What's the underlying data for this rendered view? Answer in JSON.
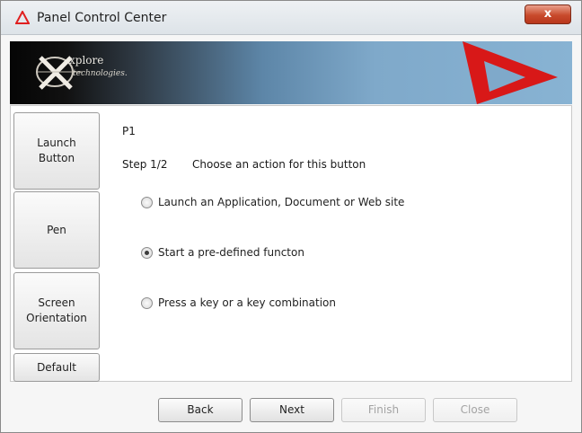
{
  "window": {
    "title": "Panel Control Center",
    "close_label": "x"
  },
  "banner": {
    "logo_line1": "xplore",
    "logo_line2": "technologies."
  },
  "sidebar": {
    "items": [
      {
        "lines": [
          "Launch",
          "Button"
        ]
      },
      {
        "lines": [
          "Pen"
        ]
      },
      {
        "lines": [
          "Screen",
          "Orientation"
        ]
      },
      {
        "lines": [
          "Default"
        ]
      }
    ]
  },
  "main": {
    "panel_label": "P1",
    "step": "Step 1/2",
    "step_description": "Choose an action for this button",
    "options": [
      {
        "label": "Launch an Application, Document or Web site",
        "selected": false
      },
      {
        "label": "Start a pre-defined functon",
        "selected": true
      },
      {
        "label": "Press a key or a key combination",
        "selected": false
      }
    ]
  },
  "footer": {
    "back": "Back",
    "next": "Next",
    "finish": "Finish",
    "close": "Close"
  },
  "colors": {
    "accent_red": "#e02020",
    "banner_blue": "#7fa9ca"
  }
}
